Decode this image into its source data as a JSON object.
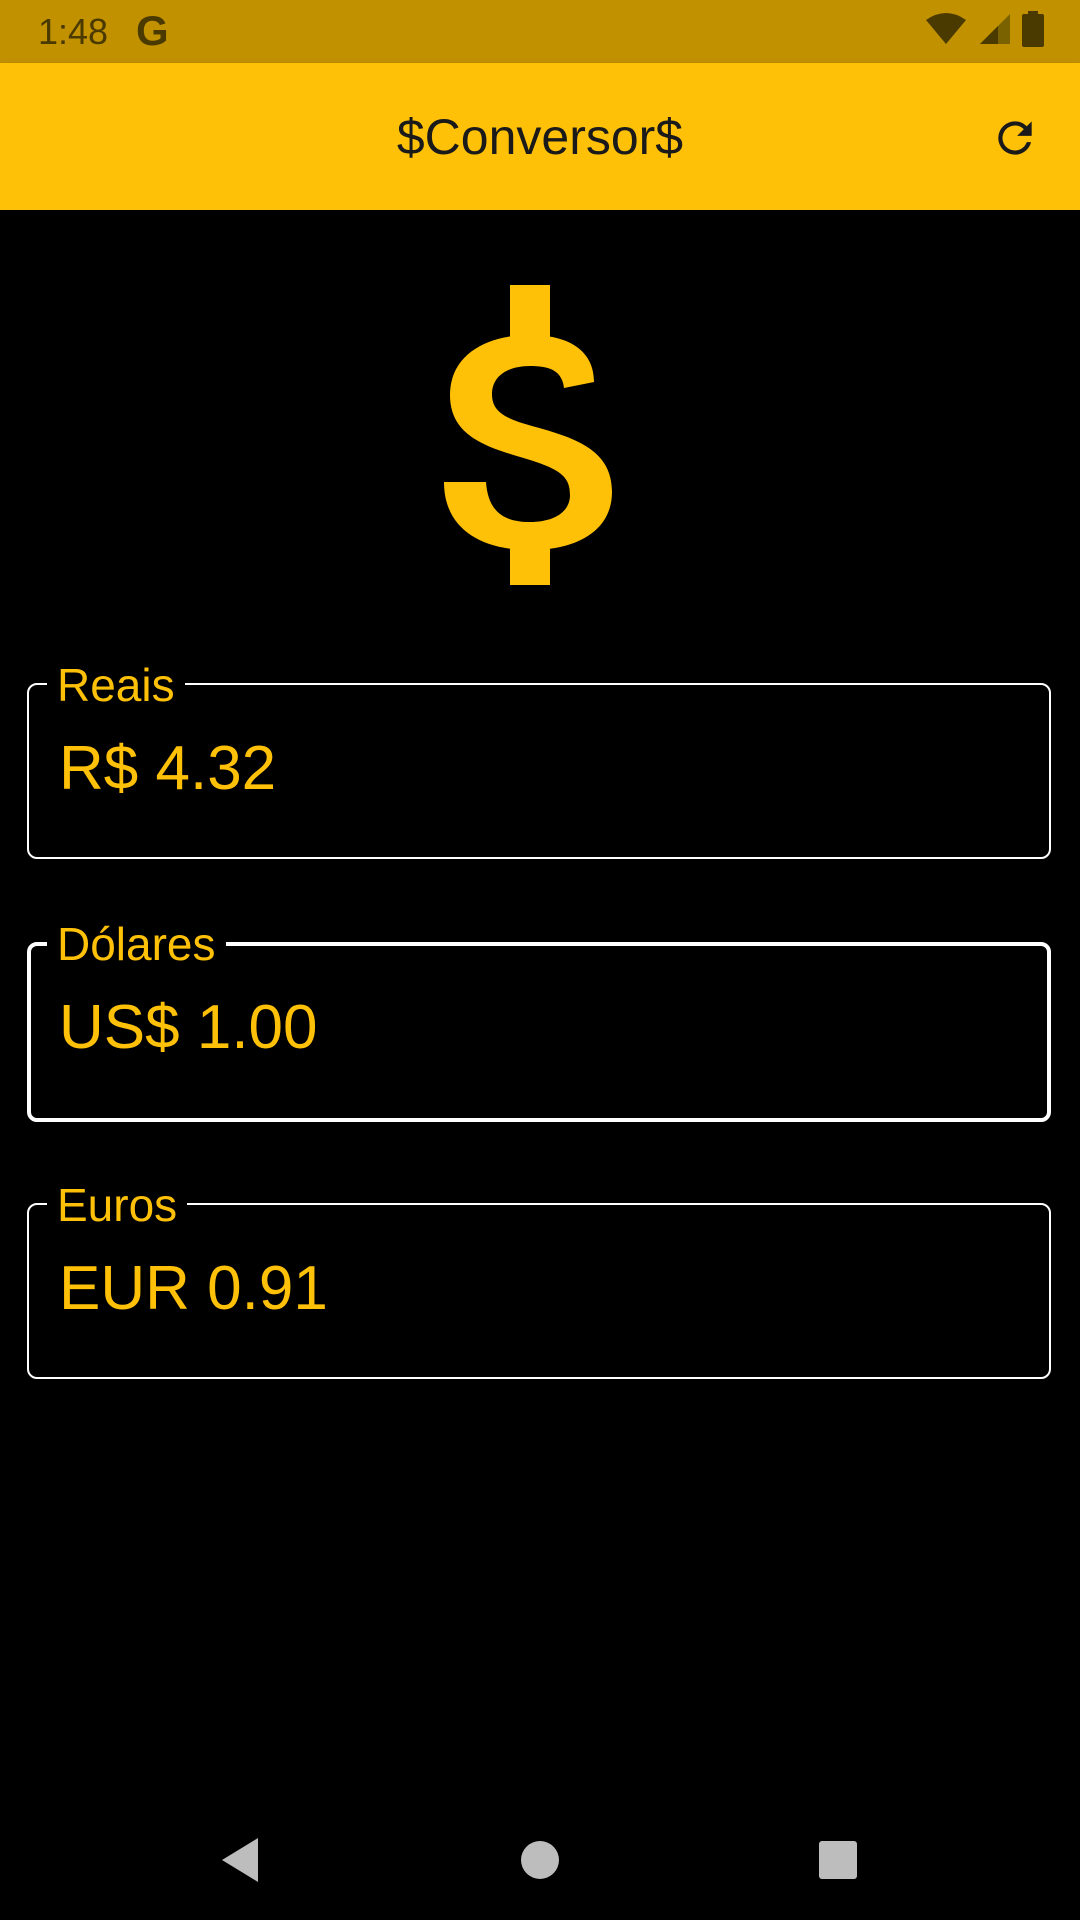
{
  "status_bar": {
    "time": "1:48",
    "g_icon": "G",
    "icons": [
      "wifi-icon",
      "signal-icon",
      "battery-icon"
    ]
  },
  "app_bar": {
    "title": "$Conversor$",
    "action_icon": "refresh-icon"
  },
  "hero": {
    "icon": "dollar-sign-icon"
  },
  "fields": [
    {
      "label": "Reais",
      "value": "R$ 4.32",
      "focused": false
    },
    {
      "label": "Dólares",
      "value": "US$ 1.00",
      "focused": true
    },
    {
      "label": "Euros",
      "value": "EUR 0.91",
      "focused": false
    }
  ],
  "nav": {
    "buttons": [
      "back-icon",
      "home-icon",
      "recents-icon"
    ]
  },
  "colors": {
    "accent": "#FFC107",
    "status_bar": "#C19100",
    "background": "#000000",
    "border": "#FFFFFF"
  }
}
